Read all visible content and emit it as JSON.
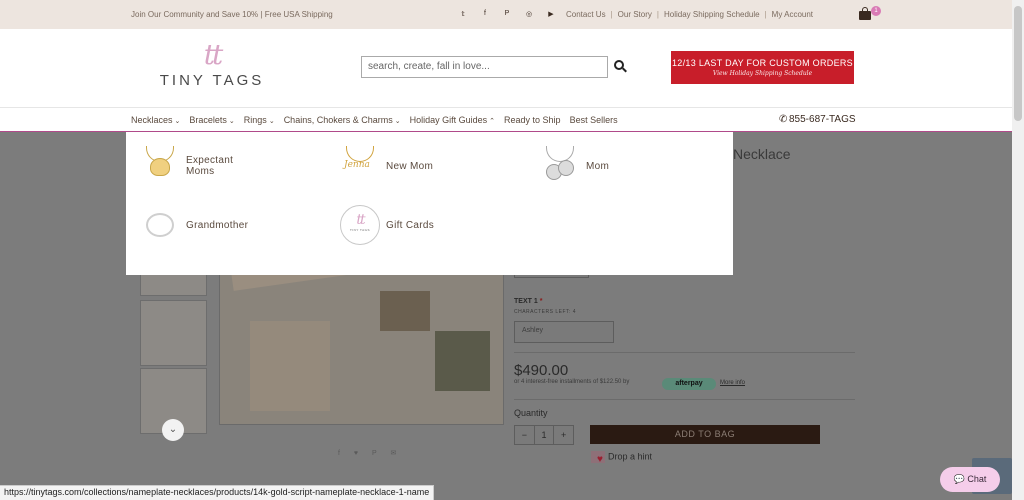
{
  "topbar": {
    "promo": "Join Our Community and Save 10% |   Free USA Shipping",
    "social_icons": [
      "twitter-icon",
      "facebook-icon",
      "pinterest-icon",
      "instagram-icon",
      "youtube-icon"
    ],
    "social_glyphs": [
      "𝕥",
      "f",
      "P",
      "◎",
      "▶"
    ],
    "links": [
      "Contact Us",
      "Our Story",
      "Holiday Shipping Schedule",
      "My Account"
    ],
    "cart_count": "1"
  },
  "header": {
    "logo_mark": "tt",
    "logo_text": "TINY TAGS",
    "search_placeholder": "search, create, fall in love...",
    "banner_line1": "12/13 LAST DAY FOR CUSTOM ORDERS",
    "banner_line2": "View Holiday Shipping Schedule"
  },
  "nav": {
    "items": [
      {
        "label": "Necklaces",
        "chevron": "⌄"
      },
      {
        "label": "Bracelets",
        "chevron": "⌄"
      },
      {
        "label": "Rings",
        "chevron": "⌄"
      },
      {
        "label": "Chains, Chokers & Charms",
        "chevron": "⌄"
      },
      {
        "label": "Holiday Gift Guides",
        "chevron": "⌃"
      },
      {
        "label": "Ready to Ship",
        "chevron": ""
      },
      {
        "label": "Best Sellers",
        "chevron": ""
      }
    ],
    "phone": "855-687-TAGS"
  },
  "dropdown": {
    "items": [
      {
        "label_line1": "Expectant",
        "label_line2": "Moms"
      },
      {
        "label_line1": "New Mom",
        "label_line2": ""
      },
      {
        "label_line1": "Mom",
        "label_line2": ""
      },
      {
        "label_line1": "Grandmother",
        "label_line2": ""
      },
      {
        "label_line1": "Gift Cards",
        "label_line2": ""
      }
    ]
  },
  "product": {
    "title_fragment": "Necklace",
    "text_label": "TEXT 1",
    "required_mark": "*",
    "chars_left": "CHARACTERS LEFT: 4",
    "text_value": "Ashley",
    "price": "$490.00",
    "installments_text": "or 4 interest-free installments of $122.50 by",
    "afterpay_label": "afterpay",
    "more_info": "More info",
    "quantity_label": "Quantity",
    "qty_minus": "−",
    "qty_value": "1",
    "qty_plus": "+",
    "add_to_bag": "ADD TO BAG",
    "drop_hint": "Drop a hint",
    "share_icons": "f ♥ P ✉",
    "scroll_down": "⌄"
  },
  "chat": {
    "label": "Chat",
    "icon": "💬"
  },
  "status_url": "https://tinytags.com/collections/nameplate-necklaces/products/14k-gold-script-nameplate-necklace-1-name"
}
